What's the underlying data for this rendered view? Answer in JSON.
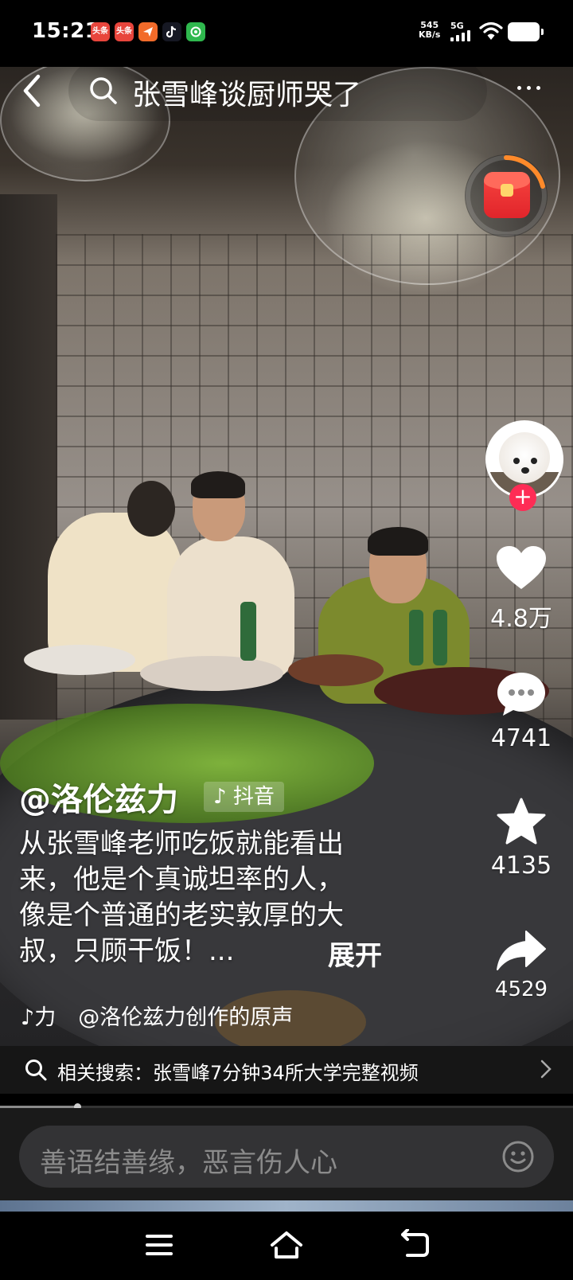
{
  "status_bar": {
    "time": "15:21",
    "net_speed_value": "545",
    "net_speed_unit": "KB/s",
    "network": "5G",
    "notification_icons": [
      {
        "name": "toutiao-icon",
        "text": "头条",
        "color": "#e8453c"
      },
      {
        "name": "toutiao-lite-icon",
        "text": "头条",
        "color": "#e8453c"
      },
      {
        "name": "send-app-icon",
        "text": "",
        "color": "#f26b2a"
      },
      {
        "name": "douyin-icon",
        "text": "",
        "color": "#161823"
      },
      {
        "name": "green-app-icon",
        "text": "",
        "color": "#2fb84e"
      }
    ]
  },
  "search": {
    "query": "张雪峰谈厨师哭了"
  },
  "video": {
    "author": "@洛伦兹力",
    "platform_tag": "抖音",
    "description_lines": [
      "从张雪峰老师吃饭就能看出",
      "来，他是个真诚坦率的人，",
      "像是个普通的老实敦厚的大",
      "叔，只顾干饭！..."
    ],
    "expand_label": "展开",
    "music_short": "力",
    "music_source": "@洛伦兹力创作的原声",
    "progress_fraction": 0.135
  },
  "actions": {
    "likes": "4.8万",
    "comments": "4741",
    "favorites": "4135",
    "shares": "4529"
  },
  "related_search": {
    "label": "相关搜索：",
    "query": "张雪峰7分钟34所大学完整视频"
  },
  "comment_bar": {
    "placeholder": "善语结善缘，恶言伤人心"
  },
  "colors": {
    "follow_red": "#fe2c55",
    "timer_ring": "#ff8a2a"
  }
}
